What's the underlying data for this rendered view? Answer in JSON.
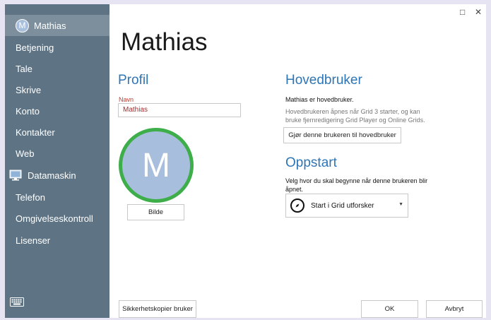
{
  "window_controls": {
    "maximize": "□",
    "close": "✕"
  },
  "sidebar": {
    "user_initial": "M",
    "items": [
      {
        "label": "Mathias",
        "active": true
      },
      {
        "label": "Betjening"
      },
      {
        "label": "Tale"
      },
      {
        "label": "Skrive"
      },
      {
        "label": "Konto"
      },
      {
        "label": "Kontakter"
      },
      {
        "label": "Web"
      },
      {
        "label": "Datamaskin",
        "icon": "monitor-icon"
      },
      {
        "label": "Telefon"
      },
      {
        "label": "Omgivelseskontroll"
      },
      {
        "label": "Lisenser"
      }
    ],
    "footer_icon": "keyboard-icon"
  },
  "main": {
    "title": "Mathias",
    "profile": {
      "heading": "Profil",
      "name_label": "Navn",
      "name_value": "Mathias",
      "avatar_initial": "M",
      "picture_button": "Bilde"
    },
    "main_user": {
      "heading": "Hovedbruker",
      "status": "Mathias er hovedbruker.",
      "description_line1": "Hovedbrukeren åpnes når Grid 3 starter, og kan",
      "description_line2": "bruke fjernredigering Grid Player og Online Grids.",
      "make_main_button": "Gjør denne brukeren til hovedbruker"
    },
    "startup": {
      "heading": "Oppstart",
      "description_line1": "Velg hvor du skal begynne når denne brukeren blir",
      "description_line2": "åpnet.",
      "selected_option": "Start i Grid utforsker",
      "option_icon": "compass-icon"
    },
    "footer": {
      "backup_button": "Sikkerhetskopier bruker",
      "ok_button": "OK",
      "cancel_button": "Avbryt"
    }
  },
  "colors": {
    "sidebar_bg": "#5e7485",
    "sidebar_active": "#7d8f9c",
    "accent": "#2e75b6",
    "avatar_ring": "#3dae49",
    "avatar_fill": "#a8bedd"
  }
}
